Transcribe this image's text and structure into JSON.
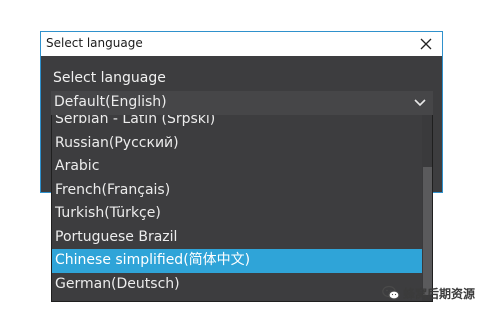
{
  "window": {
    "title": "Select language",
    "label": "Select language"
  },
  "combo": {
    "selected_value": "Default(English)"
  },
  "dropdown": {
    "items": [
      "Serbian - Latin (Srpski)",
      "Russian(Русский)",
      "Arabic",
      "French(Français)",
      "Turkish(Türkçe)",
      "Portuguese Brazil",
      "Chinese simplified(简体中文)",
      "German(Deutsch)"
    ],
    "highlighted_item": "Chinese simplified(简体中文)"
  },
  "watermark": {
    "text": "蜂窝后期资源"
  },
  "colors": {
    "accent": "#2fa4d8",
    "window_border": "#2f91cc",
    "background_dark": "#3d3d3f"
  },
  "icons": [
    "close-icon",
    "chevron-down-icon",
    "wechat-icon"
  ]
}
